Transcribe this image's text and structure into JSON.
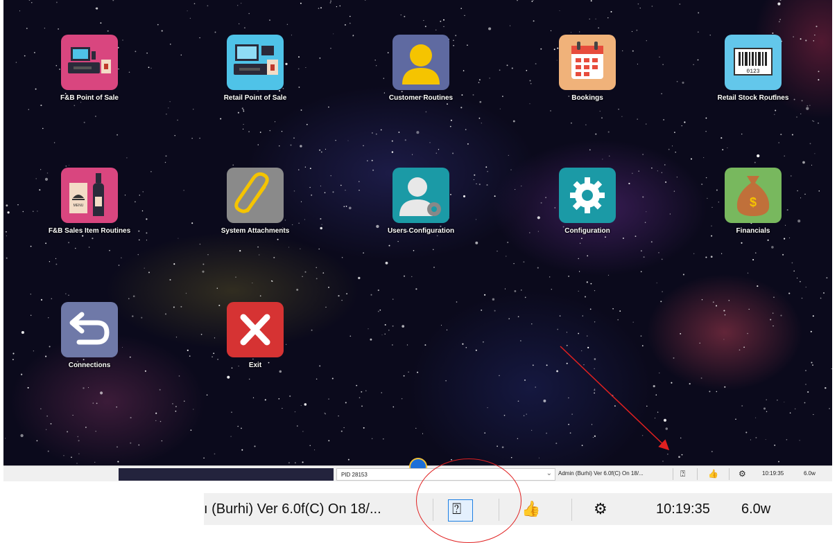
{
  "apps": [
    {
      "label": "F&B Point of Sale",
      "color": "#d9467f",
      "icon": "pos-register-icon"
    },
    {
      "label": "Retail Point of Sale",
      "color": "#4fc3e8",
      "icon": "retail-register-icon"
    },
    {
      "label": "Customer Routines",
      "color": "#5f6aa1",
      "icon": "user-icon"
    },
    {
      "label": "Bookings",
      "color": "#f0b27a",
      "icon": "calendar-icon"
    },
    {
      "label": "Retail Stock Routines",
      "color": "#63c7eb",
      "icon": "barcode-icon"
    },
    {
      "label": "F&B Sales Item Routines",
      "color": "#d9467f",
      "icon": "menu-bottle-icon"
    },
    {
      "label": "System Attachments",
      "color": "#8a8a8a",
      "icon": "paperclip-icon"
    },
    {
      "label": "Users Configuration",
      "color": "#1b9aa6",
      "icon": "user-gear-icon"
    },
    {
      "label": "Configuration",
      "color": "#1b9aa6",
      "icon": "gear-icon"
    },
    {
      "label": "Financials",
      "color": "#78b85e",
      "icon": "money-bag-icon"
    },
    {
      "label": "Connections",
      "color": "#6f79a8",
      "icon": "return-arrow-icon"
    },
    {
      "label": "Exit",
      "color": "#d63333",
      "icon": "close-x-icon"
    }
  ],
  "status_bar": {
    "pid": "PID 28153",
    "admin": "Admin (Burhi) Ver 6.0f(C) On 18/...",
    "time": "10:19:35",
    "version": "6.0w"
  },
  "zoom_strip": {
    "admin": "ı (Burhi) Ver 6.0f(C) On 18/...",
    "time": "10:19:35",
    "version": "6.0w"
  },
  "annotation_color": "#e02020"
}
